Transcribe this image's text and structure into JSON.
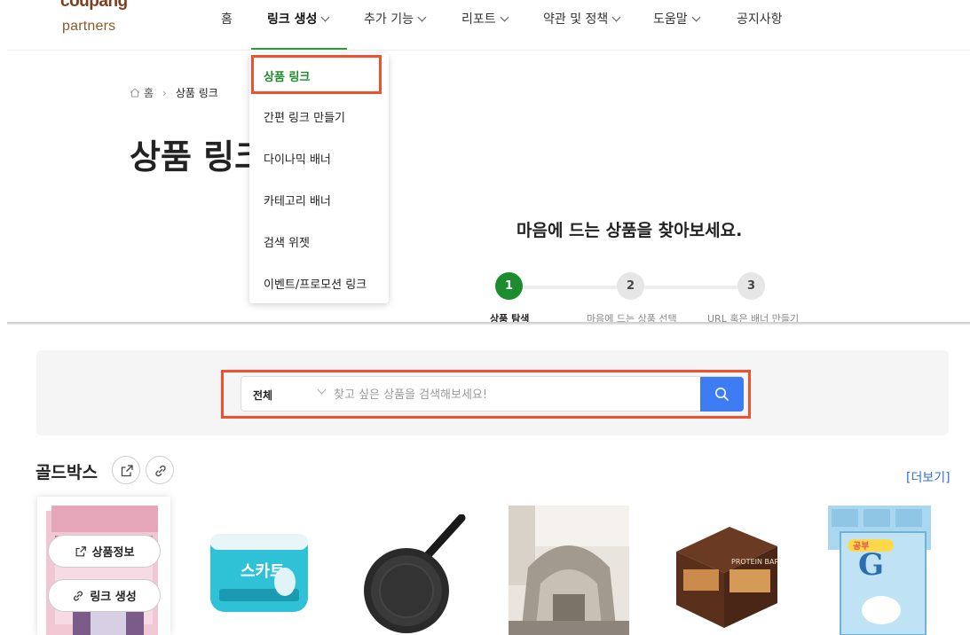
{
  "logo": {
    "line1": "coupang",
    "line2": "partners",
    "colors": [
      "#7b3f1f",
      "#e3262f",
      "#f3a21a",
      "#7bb83b",
      "#2d9bd8"
    ]
  },
  "nav": {
    "items": [
      {
        "label": "홈",
        "has_chevron": false
      },
      {
        "label": "링크 생성",
        "has_chevron": true,
        "active": true
      },
      {
        "label": "추가 기능",
        "has_chevron": true
      },
      {
        "label": "리포트",
        "has_chevron": true
      },
      {
        "label": "약관 및 정책",
        "has_chevron": true
      },
      {
        "label": "도움말",
        "has_chevron": true
      },
      {
        "label": "공지사항",
        "has_chevron": false
      }
    ],
    "active_color": "#2f9a3a"
  },
  "breadcrumb": {
    "home": "홈",
    "current": "상품 링크"
  },
  "page": {
    "title": "상품 링크"
  },
  "dropdown": {
    "items": [
      {
        "label": "상품 링크",
        "selected": true
      },
      {
        "label": "간편 링크 만들기"
      },
      {
        "label": "다이나믹 배너"
      },
      {
        "label": "카테고리 배너"
      },
      {
        "label": "검색 위젯"
      },
      {
        "label": "이벤트/프로모션 링크"
      }
    ],
    "highlight_color": "#f1502f"
  },
  "hero": {
    "headline": "마음에 드는 상품을 찾아보세요.",
    "steps": [
      {
        "number": "1",
        "label": "상품 탐색",
        "active": true
      },
      {
        "number": "2",
        "label": "마음에 드는 상품 선택"
      },
      {
        "number": "3",
        "label": "URL 혹은 배너 만들기"
      }
    ]
  },
  "search": {
    "scope": "전체",
    "placeholder": "찾고 싶은 상품을 검색해보세요!",
    "value": "",
    "button_color": "#3d7cf2"
  },
  "goldbox": {
    "title": "골드박스",
    "more": "[더보기]",
    "card_buttons": {
      "info": "상품정보",
      "link": "링크 생성"
    },
    "products": [
      {
        "icon": "pink-product-box-image"
      },
      {
        "icon": "wet-wipes-pack-image"
      },
      {
        "icon": "frying-pan-image"
      },
      {
        "icon": "indoor-tent-image"
      },
      {
        "icon": "protein-bar-box-image"
      },
      {
        "icon": "cinnamoroll-stationery-image"
      }
    ]
  }
}
